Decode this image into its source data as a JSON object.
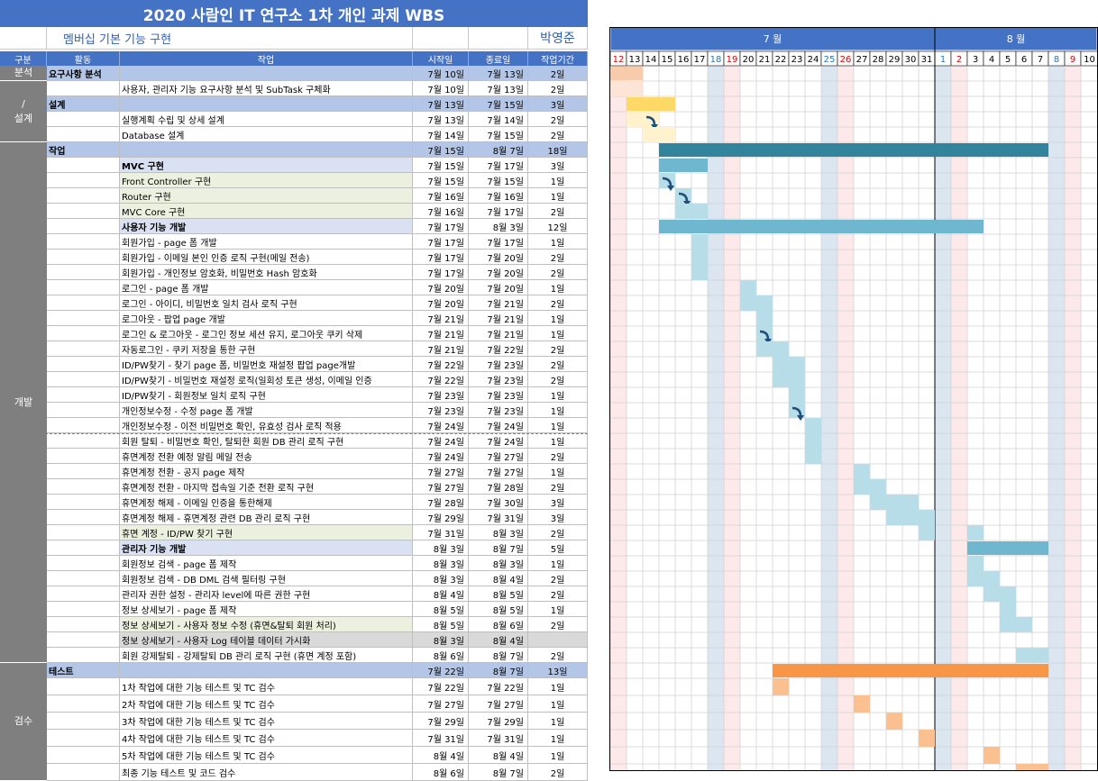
{
  "title": "2020 사람인 IT 연구소 1차 개인 과제 WBS",
  "subtitle": "멤버십 기본 기능 구현",
  "author": "박영준",
  "headers": {
    "phase": "구분",
    "activity": "활동",
    "task": "작업",
    "start": "시작일",
    "end": "종료일",
    "duration": "작업기간"
  },
  "months": [
    {
      "label": "7 월",
      "from": 0,
      "to": 20
    },
    {
      "label": "8 월",
      "from": 20,
      "to": 30
    }
  ],
  "days": [
    {
      "d": "12",
      "t": "sun"
    },
    {
      "d": "13",
      "t": ""
    },
    {
      "d": "14",
      "t": ""
    },
    {
      "d": "15",
      "t": ""
    },
    {
      "d": "16",
      "t": ""
    },
    {
      "d": "17",
      "t": ""
    },
    {
      "d": "18",
      "t": "sat"
    },
    {
      "d": "19",
      "t": "sun"
    },
    {
      "d": "20",
      "t": ""
    },
    {
      "d": "21",
      "t": ""
    },
    {
      "d": "22",
      "t": ""
    },
    {
      "d": "23",
      "t": ""
    },
    {
      "d": "24",
      "t": ""
    },
    {
      "d": "25",
      "t": "sat"
    },
    {
      "d": "26",
      "t": "sun"
    },
    {
      "d": "27",
      "t": ""
    },
    {
      "d": "28",
      "t": ""
    },
    {
      "d": "29",
      "t": ""
    },
    {
      "d": "30",
      "t": ""
    },
    {
      "d": "31",
      "t": ""
    },
    {
      "d": "1",
      "t": "sat"
    },
    {
      "d": "2",
      "t": "sun"
    },
    {
      "d": "3",
      "t": ""
    },
    {
      "d": "4",
      "t": ""
    },
    {
      "d": "5",
      "t": ""
    },
    {
      "d": "6",
      "t": ""
    },
    {
      "d": "7",
      "t": ""
    },
    {
      "d": "8",
      "t": "sat"
    },
    {
      "d": "9",
      "t": "sun"
    },
    {
      "d": "10",
      "t": ""
    }
  ],
  "phases": [
    {
      "label": "분석",
      "rows": [
        0,
        0
      ]
    },
    {
      "label": "/\n설계",
      "rows": [
        1,
        4
      ]
    },
    {
      "label": "개발",
      "rows": [
        5,
        38
      ]
    },
    {
      "label": "검수",
      "rows": [
        39,
        45
      ]
    }
  ],
  "rows": [
    {
      "type": "section",
      "activity": "요구사항 분석",
      "task": "",
      "start": "7월 10일",
      "end": "7월 13일",
      "dur": "2일",
      "bar": {
        "from": 0,
        "to": 2
      },
      "color": "#f8cbad"
    },
    {
      "type": "item",
      "task": "사용자, 관리자 기능 요구사항 분석 및 SubTask 구체화",
      "start": "7월 10일",
      "end": "7월 13일",
      "dur": "2일",
      "bar": {
        "from": 0,
        "to": 2
      },
      "color": "#fce4d6"
    },
    {
      "type": "section",
      "activity": "설계",
      "task": "",
      "start": "7월 13일",
      "end": "7월 15일",
      "dur": "3일",
      "bar": {
        "from": 1,
        "to": 4
      },
      "color": "#ffd966"
    },
    {
      "type": "item",
      "task": "실행계획 수립 및 상세 설계",
      "start": "7월 13일",
      "end": "7월 14일",
      "dur": "2일",
      "bar": {
        "from": 1,
        "to": 3
      },
      "color": "#fff2cc",
      "arrow": true
    },
    {
      "type": "item",
      "task": "Database 설계",
      "start": "7월 14일",
      "end": "7월 15일",
      "dur": "2일",
      "bar": {
        "from": 2,
        "to": 4
      },
      "color": "#fff2cc"
    },
    {
      "type": "section",
      "activity": "작업",
      "task": "",
      "start": "7월 15일",
      "end": "8월 7일",
      "dur": "18일",
      "bar": {
        "from": 3,
        "to": 27
      },
      "color": "#31849b"
    },
    {
      "type": "group",
      "task": "MVC 구현",
      "start": "7월 15일",
      "end": "7월 17일",
      "dur": "3일",
      "bar": {
        "from": 3,
        "to": 6
      },
      "color": "#6fb7cf"
    },
    {
      "type": "sub",
      "task": "Front Controller 구현",
      "start": "7월 15일",
      "end": "7월 15일",
      "dur": "1일",
      "bar": {
        "from": 3,
        "to": 4
      },
      "color": "#b7dde8",
      "arrow": true
    },
    {
      "type": "sub",
      "task": "Router 구현",
      "start": "7월 16일",
      "end": "7월 16일",
      "dur": "1일",
      "bar": {
        "from": 4,
        "to": 5
      },
      "color": "#b7dde8",
      "arrow": true
    },
    {
      "type": "sub",
      "task": "MVC Core 구현",
      "start": "7월 16일",
      "end": "7월 17일",
      "dur": "2일",
      "bar": {
        "from": 4,
        "to": 6
      },
      "color": "#b7dde8"
    },
    {
      "type": "group",
      "task": "사용자 기능 개발",
      "start": "7월 17일",
      "end": "8월 3일",
      "dur": "12일",
      "bar": {
        "from": 3,
        "to": 23
      },
      "color": "#6fb7cf"
    },
    {
      "type": "item",
      "task": "회원가입 - page 폼 개발",
      "start": "7월 17일",
      "end": "7월 17일",
      "dur": "1일",
      "bar": {
        "from": 5,
        "to": 6
      },
      "color": "#b7dde8"
    },
    {
      "type": "item",
      "task": "회원가입 - 이메일 본인 인증 로직 구현(메일 전송)",
      "start": "7월 17일",
      "end": "7월 20일",
      "dur": "2일",
      "bar": {
        "from": 5,
        "to": 6
      },
      "color": "#b7dde8"
    },
    {
      "type": "item",
      "task": "회원가입 - 개인정보 암호화, 비밀번호 Hash 암호화",
      "start": "7월 17일",
      "end": "7월 20일",
      "dur": "2일",
      "bar": {
        "from": 5,
        "to": 6
      },
      "color": "#b7dde8"
    },
    {
      "type": "item",
      "task": "로그인 - page 폼 개발",
      "start": "7월 20일",
      "end": "7월 20일",
      "dur": "1일",
      "bar": {
        "from": 8,
        "to": 9
      },
      "color": "#b7dde8"
    },
    {
      "type": "item",
      "task": "로그인 - 아이디, 비밀번호 일치 검사 로직 구현",
      "start": "7월 20일",
      "end": "7월 21일",
      "dur": "2일",
      "bar": {
        "from": 8,
        "to": 10
      },
      "color": "#b7dde8"
    },
    {
      "type": "item",
      "task": "로그아웃 - 팝업 page 개발",
      "start": "7월 21일",
      "end": "7월 21일",
      "dur": "1일",
      "bar": {
        "from": 9,
        "to": 10
      },
      "color": "#b7dde8"
    },
    {
      "type": "item",
      "task": "로그인 & 로그아웃 - 로그인 정보 세션 유지, 로그아웃 쿠키 삭제",
      "start": "7월 21일",
      "end": "7월 21일",
      "dur": "1일",
      "bar": {
        "from": 9,
        "to": 10
      },
      "color": "#b7dde8",
      "arrow": true
    },
    {
      "type": "item",
      "task": "자동로그인 - 쿠키 저장을 통한 구현",
      "start": "7월 21일",
      "end": "7월 22일",
      "dur": "2일",
      "bar": {
        "from": 9,
        "to": 11
      },
      "color": "#b7dde8"
    },
    {
      "type": "item",
      "task": "ID/PW찾기 - 찾기 page 폼, 비밀번호 재설정 팝업 page개발",
      "start": "7월 22일",
      "end": "7월 23일",
      "dur": "2일",
      "bar": {
        "from": 10,
        "to": 12
      },
      "color": "#b7dde8"
    },
    {
      "type": "item",
      "task": "ID/PW찾기 - 비밀번호 재설정 로직(일회성 토큰 생성, 이메일 인증",
      "start": "7월 22일",
      "end": "7월 23일",
      "dur": "2일",
      "bar": {
        "from": 10,
        "to": 12
      },
      "color": "#b7dde8"
    },
    {
      "type": "item",
      "task": "ID/PW찾기 - 회원정보 일치 로직 구현",
      "start": "7월 23일",
      "end": "7월 23일",
      "dur": "1일",
      "bar": {
        "from": 11,
        "to": 12
      },
      "color": "#b7dde8"
    },
    {
      "type": "item",
      "task": "개인정보수정 - 수정 page 폼 개발",
      "start": "7월 23일",
      "end": "7월 23일",
      "dur": "1일",
      "bar": {
        "from": 11,
        "to": 12
      },
      "color": "#b7dde8",
      "arrow": true
    },
    {
      "type": "item",
      "task": "개인정보수정 - 이전 비밀번호 확인, 유효성 검사 로직 적용",
      "start": "7월 24일",
      "end": "7월 24일",
      "dur": "1일",
      "bar": {
        "from": 12,
        "to": 13
      },
      "color": "#b7dde8"
    },
    {
      "type": "item",
      "task": "회원 탈퇴 - 비밀번호 확인, 탈퇴한 회원 DB 관리 로직 구현",
      "start": "7월 24일",
      "end": "7월 24일",
      "dur": "1일",
      "bar": {
        "from": 12,
        "to": 13
      },
      "color": "#b7dde8"
    },
    {
      "type": "item",
      "task": "휴면계정 전환 예정 알림 메일 전송",
      "start": "7월 24일",
      "end": "7월 27일",
      "dur": "2일",
      "bar": {
        "from": 12,
        "to": 13
      },
      "color": "#b7dde8"
    },
    {
      "type": "item",
      "task": "휴면계정 전환 - 공지 page 제작",
      "start": "7월 27일",
      "end": "7월 27일",
      "dur": "1일",
      "bar": {
        "from": 15,
        "to": 16
      },
      "color": "#b7dde8"
    },
    {
      "type": "item",
      "task": "휴면계정 전환 - 마지막 접속일 기준 전환 로직 구현",
      "start": "7월 27일",
      "end": "7월 28일",
      "dur": "2일",
      "bar": {
        "from": 15,
        "to": 17
      },
      "color": "#b7dde8"
    },
    {
      "type": "item",
      "task": "휴면계정 해제 - 이메일 인증을 통한해제",
      "start": "7월 28일",
      "end": "7월 30일",
      "dur": "3일",
      "bar": {
        "from": 16,
        "to": 19
      },
      "color": "#b7dde8"
    },
    {
      "type": "item",
      "task": "휴면계정 해제 - 휴면계정 관련 DB 관리 로직 구현",
      "start": "7월 29일",
      "end": "7월 31일",
      "dur": "3일",
      "bar": {
        "from": 17,
        "to": 20
      },
      "color": "#b7dde8"
    },
    {
      "type": "sub",
      "task": "휴면 계정 - ID/PW 찾기 구현",
      "start": "7월 31일",
      "end": "8월 3일",
      "dur": "2일",
      "bar": {
        "from": 19,
        "to": 20
      },
      "color": "#b7dde8",
      "bar2": {
        "from": 22,
        "to": 23
      }
    },
    {
      "type": "group",
      "task": "관리자 기능 개발",
      "start": "8월 3일",
      "end": "8월 7일",
      "dur": "5일",
      "bar": {
        "from": 22,
        "to": 27
      },
      "color": "#6fb7cf"
    },
    {
      "type": "item",
      "task": "회원정보 검색 - page 폼 제작",
      "start": "8월 3일",
      "end": "8월 3일",
      "dur": "1일",
      "bar": {
        "from": 22,
        "to": 23
      },
      "color": "#b7dde8"
    },
    {
      "type": "item",
      "task": "회원정보 검색 - DB DML 검색 필터링 구현",
      "start": "8월 3일",
      "end": "8월 4일",
      "dur": "2일",
      "bar": {
        "from": 22,
        "to": 24
      },
      "color": "#b7dde8"
    },
    {
      "type": "item",
      "task": "관리자 권한 설정 - 관리자 level에 따른 권한 구현",
      "start": "8월 4일",
      "end": "8월 5일",
      "dur": "2일",
      "bar": {
        "from": 23,
        "to": 25
      },
      "color": "#b7dde8"
    },
    {
      "type": "item",
      "task": "정보 상세보기 - page 폼 제작",
      "start": "8월 5일",
      "end": "8월 5일",
      "dur": "1일",
      "bar": {
        "from": 24,
        "to": 25
      },
      "color": "#b7dde8"
    },
    {
      "type": "sub",
      "task": "정보 상세보기 - 사용자 정보 수정 (휴면&탈퇴 회원 처리)",
      "start": "8월 5일",
      "end": "8월 6일",
      "dur": "2일",
      "bar": {
        "from": 24,
        "to": 26
      },
      "color": "#b7dde8"
    },
    {
      "type": "gray",
      "task": "정보 상세보기 - 사용자 Log 테이블 데이터 가시화",
      "start": "8월 3일",
      "end": "8월 4일",
      "dur": "",
      "bar": null
    },
    {
      "type": "item",
      "task": "회원 강제탈퇴 - 강제탈퇴 DB 관리 로직 구현 (휴면 계정 포함)",
      "start": "8월 6일",
      "end": "8월 7일",
      "dur": "2일",
      "bar": {
        "from": 25,
        "to": 27
      },
      "color": "#b7dde8"
    },
    {
      "type": "section",
      "activity": "테스트",
      "task": "",
      "start": "7월 22일",
      "end": "8월 7일",
      "dur": "13일",
      "bar": {
        "from": 10,
        "to": 27
      },
      "color": "#f79646"
    },
    {
      "type": "item",
      "task": "1차 작업에 대한 기능 테스트 및 TC 검수",
      "start": "7월 22일",
      "end": "7월 22일",
      "dur": "1일",
      "bar": {
        "from": 10,
        "to": 11
      },
      "color": "#fac090"
    },
    {
      "type": "item",
      "task": "2차 작업에 대한 기능 테스트 및 TC 검수",
      "start": "7월 27일",
      "end": "7월 27일",
      "dur": "1일",
      "bar": {
        "from": 15,
        "to": 16
      },
      "color": "#fac090"
    },
    {
      "type": "item",
      "task": "3차 작업에 대한 기능 테스트 및 TC 검수",
      "start": "7월 29일",
      "end": "7월 29일",
      "dur": "1일",
      "bar": {
        "from": 17,
        "to": 18
      },
      "color": "#fac090"
    },
    {
      "type": "item",
      "task": "4차 작업에 대한 기능 테스트 및 TC 검수",
      "start": "7월 31일",
      "end": "7월 31일",
      "dur": "1일",
      "bar": {
        "from": 19,
        "to": 20
      },
      "color": "#fac090"
    },
    {
      "type": "item",
      "task": "5차 작업에 대한 기능 테스트 및 TC 검수",
      "start": "8월 4일",
      "end": "8월 4일",
      "dur": "1일",
      "bar": {
        "from": 23,
        "to": 24
      },
      "color": "#fac090"
    },
    {
      "type": "item",
      "task": "최종 기능 테스트 및 코드 검수",
      "start": "8월 6일",
      "end": "8월 7일",
      "dur": "2일",
      "bar": {
        "from": 25,
        "to": 27
      },
      "color": "#fac090"
    }
  ],
  "colors": {
    "header_blue": "#4472c4",
    "month_bar": "#4472c4",
    "sat_tint": "#dce6f1",
    "sun_tint": "#fde9e9",
    "sun_text": "#e00000",
    "sat_text": "#2e75b6"
  }
}
